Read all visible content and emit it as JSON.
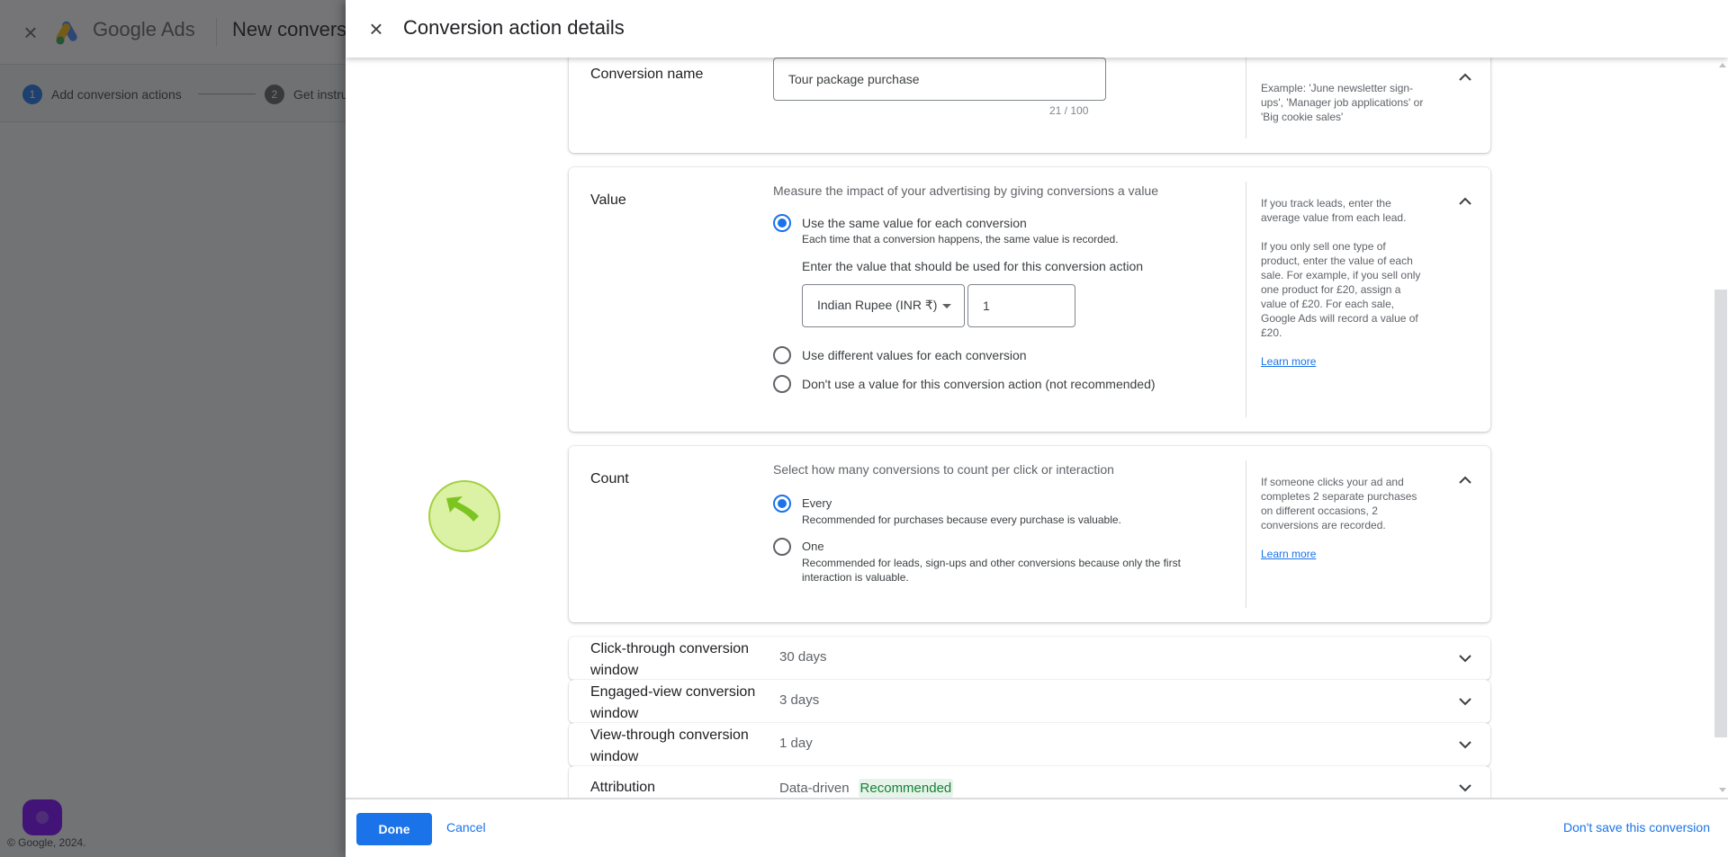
{
  "background": {
    "brand": "Google Ads",
    "page_title": "New conversion action",
    "steps": [
      {
        "number": "1",
        "label": "Add conversion actions",
        "active": true
      },
      {
        "number": "2",
        "label": "Get instructions",
        "active": false
      }
    ],
    "copyright": "© Google, 2024."
  },
  "panel": {
    "title": "Conversion action details",
    "conversion_name": {
      "label": "Conversion name",
      "value": "Tour package purchase",
      "char_count": "21 / 100",
      "help": "Example: 'June newsletter sign-ups', 'Manager job applications' or 'Big cookie sales'"
    },
    "value_section": {
      "label": "Value",
      "description": "Measure the impact of your advertising by giving conversions a value",
      "options": [
        {
          "label": "Use the same value for each conversion",
          "sub": "Each time that a conversion happens, the same value is recorded.",
          "checked": true
        },
        {
          "label": "Use different values for each conversion",
          "checked": false
        },
        {
          "label": "Don't use a value for this conversion action (not recommended)",
          "checked": false
        }
      ],
      "value_prompt": "Enter the value that should be used for this conversion action",
      "currency": "Indian Rupee (INR ₹)",
      "amount": "1",
      "help": [
        "If you track leads, enter the average value from each lead.",
        "If you only sell one type of product, enter the value of each sale. For example, if you sell only one product for £20, assign a value of £20. For each sale, Google Ads will record a value of £20."
      ],
      "learn_more": "Learn more"
    },
    "count_section": {
      "label": "Count",
      "description": "Select how many conversions to count per click or interaction",
      "options": [
        {
          "label": "Every",
          "sub": "Recommended for purchases because every purchase is valuable.",
          "checked": true
        },
        {
          "label": "One",
          "sub": "Recommended for leads, sign-ups and other conversions because only the first interaction is valuable.",
          "checked": false
        }
      ],
      "help": "If someone clicks your ad and completes 2 separate purchases on different occasions, 2 conversions are recorded.",
      "learn_more": "Learn more"
    },
    "collapsed_rows": [
      {
        "label": "Click-through conversion window",
        "value": "30 days"
      },
      {
        "label": "Engaged-view conversion window",
        "value": "3 days"
      },
      {
        "label": "View-through conversion window",
        "value": "1 day"
      },
      {
        "label": "Attribution",
        "value": "Data-driven",
        "badge": "Recommended"
      }
    ],
    "footer": {
      "done": "Done",
      "cancel": "Cancel",
      "dont_save": "Don't save this conversion"
    }
  },
  "colors": {
    "accent": "#1a73e8",
    "recommended_bg": "#e6f4ea",
    "recommended_text": "#188038",
    "click_highlight": "#bee65a"
  }
}
